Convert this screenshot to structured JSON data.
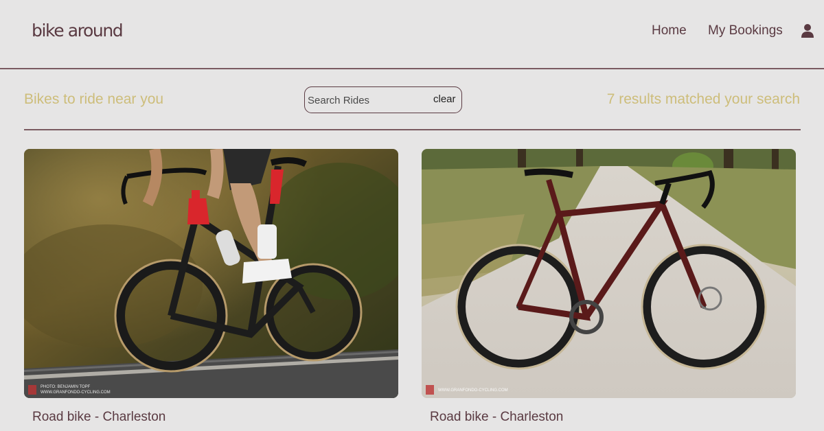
{
  "header": {
    "logo": "bike around",
    "nav": {
      "home": "Home",
      "bookings": "My Bookings"
    },
    "user_icon": "user-icon"
  },
  "subbar": {
    "title": "Bikes to ride near you",
    "search": {
      "placeholder": "Search Rides",
      "value": "",
      "clear_label": "clear"
    },
    "results": "7 results matched your search"
  },
  "cards": [
    {
      "title": "Road bike - Charleston",
      "image": "photo of rider on red and black road bike",
      "watermark_line1": "PHOTO: BENJAMIN TOPF",
      "watermark_line2": "WWW.GRANFONDO-CYCLING.COM"
    },
    {
      "title": "Road bike - Charleston",
      "image": "photo of dark red Trek road bike on gravel path",
      "watermark_line1": "",
      "watermark_line2": "WWW.GRANFONDO-CYCLING.COM"
    }
  ],
  "colors": {
    "background": "#e6e5e5",
    "primary_text": "#5a3a42",
    "accent": "#cdbd7a"
  }
}
